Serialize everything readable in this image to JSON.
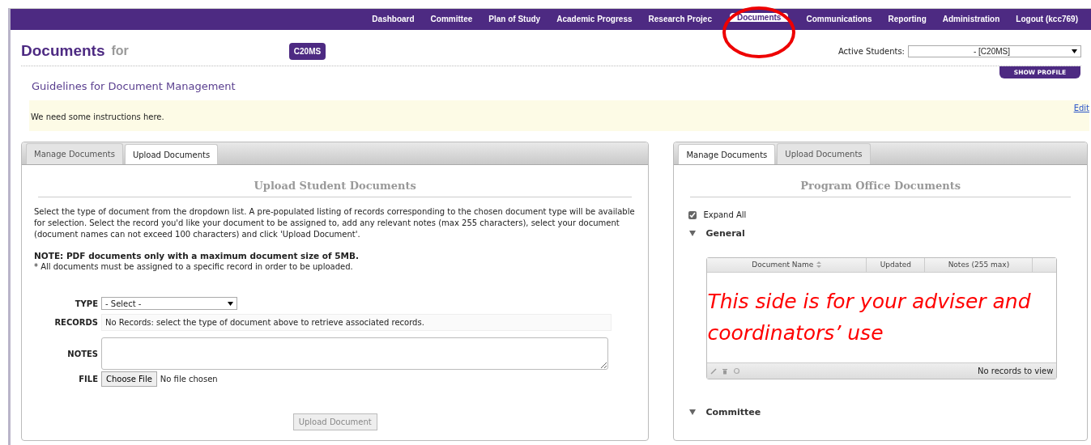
{
  "nav": {
    "items": [
      {
        "label": "Dashboard",
        "selected": false
      },
      {
        "label": "Committee",
        "selected": false
      },
      {
        "label": "Plan of Study",
        "selected": false
      },
      {
        "label": "Academic Progress",
        "selected": false
      },
      {
        "label": "Research Projec",
        "selected": false
      },
      {
        "label": "Documents",
        "selected": true
      },
      {
        "label": "Communications",
        "selected": false
      },
      {
        "label": "Reporting",
        "selected": false
      },
      {
        "label": "Administration",
        "selected": false
      },
      {
        "label": "Logout (kcc769)",
        "selected": false
      }
    ]
  },
  "header": {
    "title": "Documents",
    "for": "for",
    "student_badge": "C20MS",
    "active_students_label": "Active Students:",
    "active_students_value": "- [C20MS]",
    "show_profile": "SHOW PROFILE"
  },
  "guidelines": {
    "title": "Guidelines for Document Management",
    "text": "We need some instructions here.",
    "edit": "Edit"
  },
  "upload_panel": {
    "tabs": [
      {
        "label": "Manage Documents",
        "selected": false
      },
      {
        "label": "Upload Documents",
        "selected": true
      }
    ],
    "heading": "Upload Student Documents",
    "intro": "Select the type of document from the dropdown list. A pre-populated listing of records corresponding to the chosen document type will be available for selection. Select the record you'd like your document to be assigned to, add any relevant notes (max 255 characters), select your document (document names can not exceed 100 characters) and click 'Upload Document'.",
    "note": "NOTE: PDF documents only with a maximum document size of 5MB.",
    "asterisk_note": "* All documents must be assigned to a specific record in order to be uploaded.",
    "form": {
      "type_label": "TYPE",
      "type_value": "- Select -",
      "records_label": "RECORDS",
      "records_text": "No Records: select the type of document above to retrieve associated records.",
      "notes_label": "NOTES",
      "file_label": "FILE",
      "choose_file": "Choose File",
      "no_file": "No file chosen",
      "submit": "Upload Document",
      "submit_disabled": true
    }
  },
  "office_panel": {
    "tabs": [
      {
        "label": "Manage Documents",
        "selected": true
      },
      {
        "label": "Upload Documents",
        "selected": false
      }
    ],
    "heading": "Program Office Documents",
    "expand_all": {
      "label": "Expand All",
      "checked": true
    },
    "sections": [
      {
        "title": "General",
        "expanded": true,
        "grid": {
          "columns": [
            {
              "label": "Document Name",
              "sortable": true
            },
            {
              "label": "Updated",
              "sortable": false
            },
            {
              "label": "Notes (255 max)",
              "sortable": false
            }
          ],
          "empty_text": "No records to view"
        }
      },
      {
        "title": "Committee",
        "expanded": true
      }
    ]
  },
  "annotation": "This side is for your adviser and coordinators’ use"
}
